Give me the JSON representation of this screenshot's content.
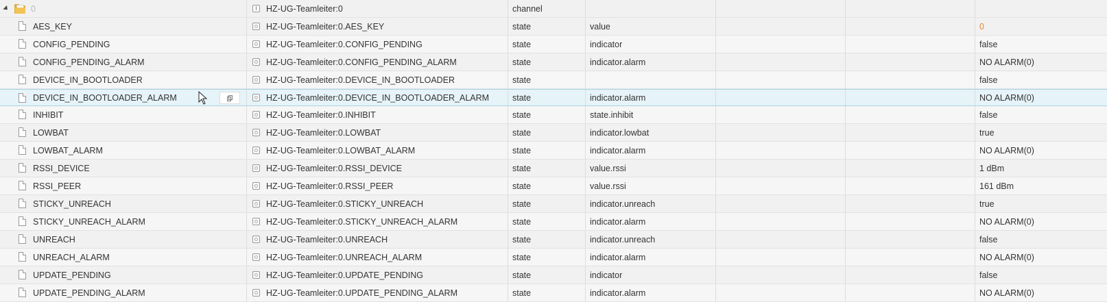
{
  "root": {
    "name": "0",
    "id": "HZ-UG-Teamleiter:0",
    "type": "channel"
  },
  "rows": [
    {
      "name": "AES_KEY",
      "id": "HZ-UG-Teamleiter:0.AES_KEY",
      "type": "state",
      "role": "value",
      "value": "0"
    },
    {
      "name": "CONFIG_PENDING",
      "id": "HZ-UG-Teamleiter:0.CONFIG_PENDING",
      "type": "state",
      "role": "indicator",
      "value": "false"
    },
    {
      "name": "CONFIG_PENDING_ALARM",
      "id": "HZ-UG-Teamleiter:0.CONFIG_PENDING_ALARM",
      "type": "state",
      "role": "indicator.alarm",
      "value": "NO ALARM(0)"
    },
    {
      "name": "DEVICE_IN_BOOTLOADER",
      "id": "HZ-UG-Teamleiter:0.DEVICE_IN_BOOTLOADER",
      "type": "state",
      "role": "",
      "value": "false"
    },
    {
      "name": "DEVICE_IN_BOOTLOADER_ALARM",
      "id": "HZ-UG-Teamleiter:0.DEVICE_IN_BOOTLOADER_ALARM",
      "type": "state",
      "role": "indicator.alarm",
      "value": "NO ALARM(0)"
    },
    {
      "name": "INHIBIT",
      "id": "HZ-UG-Teamleiter:0.INHIBIT",
      "type": "state",
      "role": "state.inhibit",
      "value": "false"
    },
    {
      "name": "LOWBAT",
      "id": "HZ-UG-Teamleiter:0.LOWBAT",
      "type": "state",
      "role": "indicator.lowbat",
      "value": "true"
    },
    {
      "name": "LOWBAT_ALARM",
      "id": "HZ-UG-Teamleiter:0.LOWBAT_ALARM",
      "type": "state",
      "role": "indicator.alarm",
      "value": "NO ALARM(0)"
    },
    {
      "name": "RSSI_DEVICE",
      "id": "HZ-UG-Teamleiter:0.RSSI_DEVICE",
      "type": "state",
      "role": "value.rssi",
      "value": "1 dBm"
    },
    {
      "name": "RSSI_PEER",
      "id": "HZ-UG-Teamleiter:0.RSSI_PEER",
      "type": "state",
      "role": "value.rssi",
      "value": "161 dBm"
    },
    {
      "name": "STICKY_UNREACH",
      "id": "HZ-UG-Teamleiter:0.STICKY_UNREACH",
      "type": "state",
      "role": "indicator.unreach",
      "value": "true"
    },
    {
      "name": "STICKY_UNREACH_ALARM",
      "id": "HZ-UG-Teamleiter:0.STICKY_UNREACH_ALARM",
      "type": "state",
      "role": "indicator.alarm",
      "value": "NO ALARM(0)"
    },
    {
      "name": "UNREACH",
      "id": "HZ-UG-Teamleiter:0.UNREACH",
      "type": "state",
      "role": "indicator.unreach",
      "value": "false"
    },
    {
      "name": "UNREACH_ALARM",
      "id": "HZ-UG-Teamleiter:0.UNREACH_ALARM",
      "type": "state",
      "role": "indicator.alarm",
      "value": "NO ALARM(0)"
    },
    {
      "name": "UPDATE_PENDING",
      "id": "HZ-UG-Teamleiter:0.UPDATE_PENDING",
      "type": "state",
      "role": "indicator",
      "value": "false"
    },
    {
      "name": "UPDATE_PENDING_ALARM",
      "id": "HZ-UG-Teamleiter:0.UPDATE_PENDING_ALARM",
      "type": "state",
      "role": "indicator.alarm",
      "value": "NO ALARM(0)"
    }
  ],
  "colors": {
    "number_value": "#e7892e",
    "selected_row": "#e6f3f8",
    "folder": "#e0a936"
  },
  "icons": {
    "expand": "caret-down-icon",
    "folder": "folder-icon",
    "state": "file-icon",
    "copy": "copy-icon",
    "cursor": "mouse-pointer-icon"
  }
}
